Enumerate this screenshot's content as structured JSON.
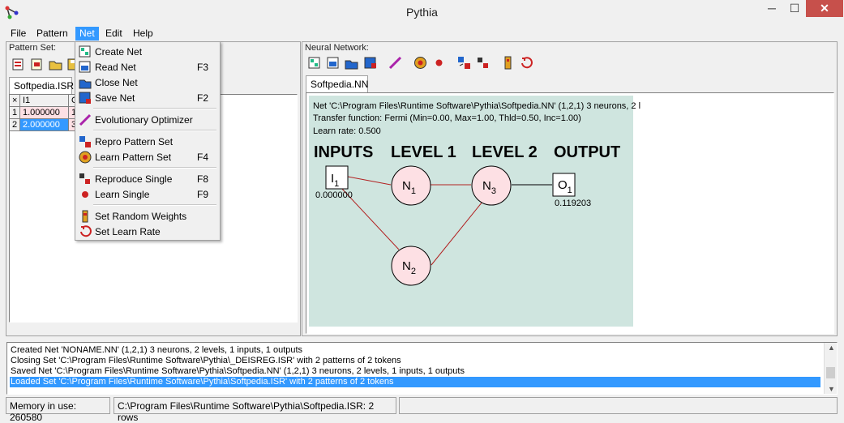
{
  "window": {
    "title": "Pythia",
    "minimize": "─",
    "maximize": "☐",
    "close": "✕"
  },
  "menu": {
    "file": "File",
    "pattern": "Pattern",
    "net": "Net",
    "edit": "Edit",
    "help": "Help"
  },
  "pattern_set": {
    "label": "Pattern Set:",
    "tab": "Softpedia.ISR",
    "grid": {
      "corner": "×",
      "headers": [
        "I1",
        "O"
      ],
      "rows": [
        {
          "num": "1",
          "i1": "1.000000",
          "o": "1"
        },
        {
          "num": "2",
          "i1": "2.000000",
          "o": "3"
        }
      ]
    }
  },
  "net_menu": {
    "create_net": "Create Net",
    "read_net": "Read Net",
    "read_net_key": "F3",
    "close_net": "Close Net",
    "save_net": "Save Net",
    "save_net_key": "F2",
    "evo": "Evolutionary Optimizer",
    "repro_set": "Repro Pattern Set",
    "learn_set": "Learn Pattern Set",
    "learn_set_key": "F4",
    "repro_single": "Reproduce Single",
    "repro_single_key": "F8",
    "learn_single": "Learn Single",
    "learn_single_key": "F9",
    "rand_weights": "Set Random Weights",
    "learn_rate": "Set Learn Rate"
  },
  "neural_network": {
    "label": "Neural Network:",
    "tab": "Softpedia.NN",
    "info_line1": "Net 'C:\\Program Files\\Runtime Software\\Pythia\\Softpedia.NN' (1,2,1) 3 neurons, 2 l",
    "info_line2": "Transfer function: Fermi (Min=0.00, Max=1.00, Thld=0.50, Inc=1.00)",
    "info_line3": "Learn rate: 0.500",
    "headings": {
      "inputs": "INPUTS",
      "level1": "LEVEL 1",
      "level2": "LEVEL 2",
      "output": "OUTPUT"
    },
    "nodes": {
      "i1": "I",
      "i1_sub": "1",
      "i1_value": "0.000000",
      "n1": "N",
      "n1_sub": "1",
      "n2": "N",
      "n2_sub": "2",
      "n3": "N",
      "n3_sub": "3",
      "o1": "O",
      "o1_sub": "1",
      "o1_value": "0.119203"
    }
  },
  "log": [
    "Created Net 'NONAME.NN' (1,2,1) 3 neurons, 2 levels, 1 inputs, 1 outputs",
    "Closing Set 'C:\\Program Files\\Runtime Software\\Pythia\\_DEISREG.ISR' with 2 patterns of 2 tokens",
    "Saved Net 'C:\\Program Files\\Runtime Software\\Pythia\\Softpedia.NN' (1,2,1) 3 neurons, 2 levels, 1 inputs, 1 outputs",
    "Loaded Set 'C:\\Program Files\\Runtime Software\\Pythia\\Softpedia.ISR' with 2 patterns of 2 tokens"
  ],
  "status": {
    "memory": "Memory in use: 260580",
    "file": "C:\\Program Files\\Runtime Software\\Pythia\\Softpedia.ISR: 2 rows"
  },
  "colors": {
    "accent": "#3399ff",
    "net_bg": "#cfe5df",
    "neuron_fill": "#fde0e4",
    "link": "#b22222"
  }
}
